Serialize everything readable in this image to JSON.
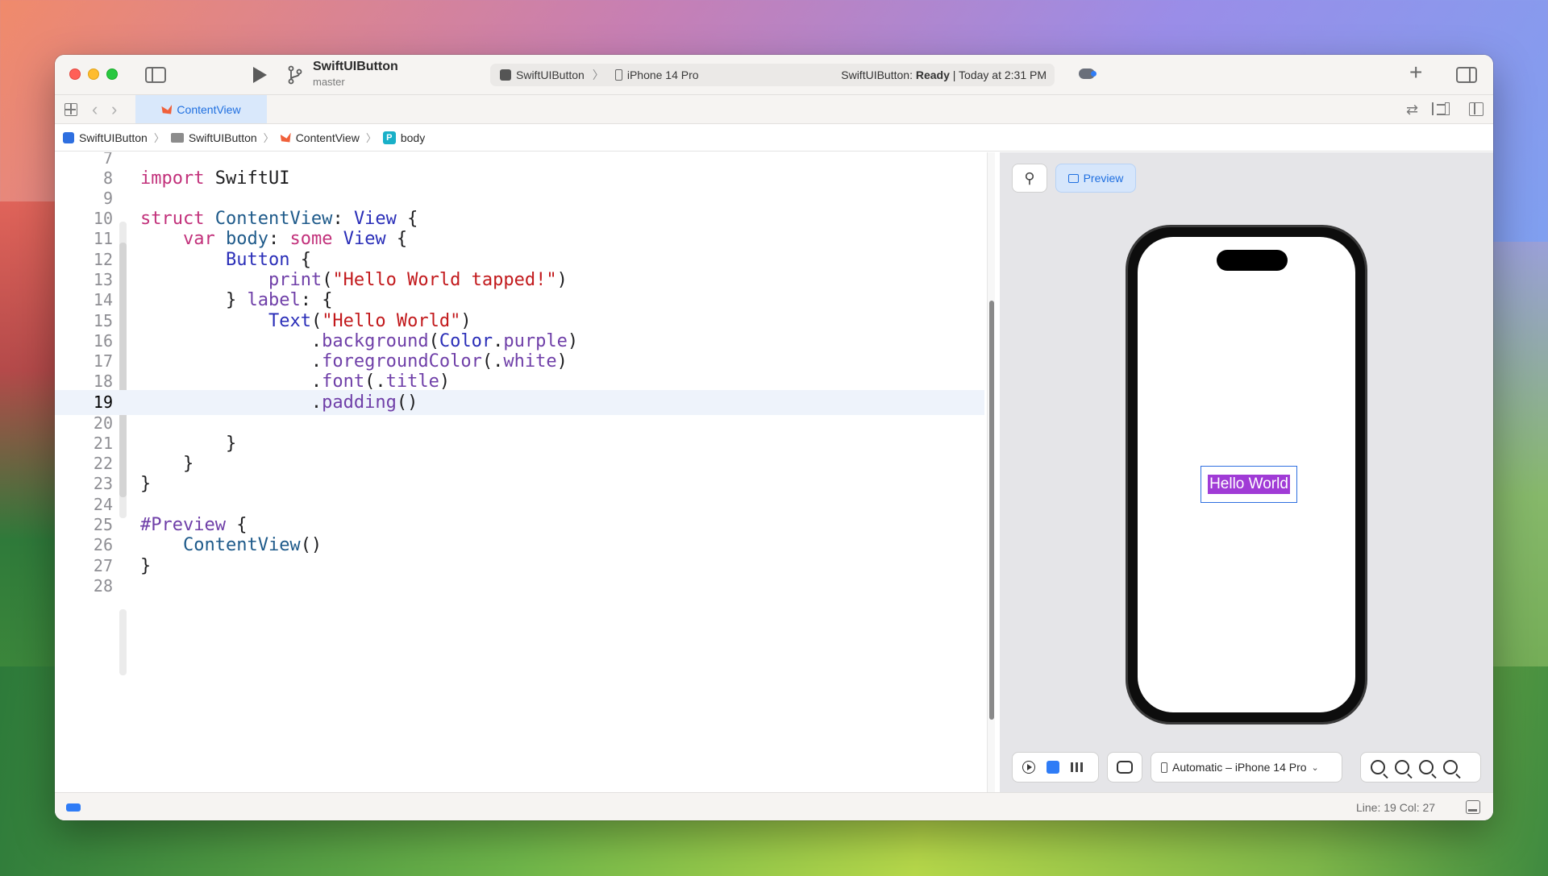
{
  "toolbar": {
    "project_title": "SwiftUIButton",
    "branch": "master",
    "scheme": "SwiftUIButton",
    "destination": "iPhone 14 Pro",
    "status_prefix": "SwiftUIButton:",
    "status_state": "Ready",
    "status_time": "| Today at 2:31 PM"
  },
  "tabs": [
    {
      "label": "ContentView",
      "active": true
    }
  ],
  "breadcrumb": [
    "SwiftUIButton",
    "SwiftUIButton",
    "ContentView",
    "body"
  ],
  "editor": {
    "current_line": 19,
    "lines": [
      {
        "n": "7"
      },
      {
        "n": "8"
      },
      {
        "n": "9"
      },
      {
        "n": "10"
      },
      {
        "n": "11"
      },
      {
        "n": "12"
      },
      {
        "n": "13"
      },
      {
        "n": "14"
      },
      {
        "n": "15"
      },
      {
        "n": "16"
      },
      {
        "n": "17"
      },
      {
        "n": "18"
      },
      {
        "n": "19"
      },
      {
        "n": "20"
      },
      {
        "n": "21"
      },
      {
        "n": "22"
      },
      {
        "n": "23"
      },
      {
        "n": "24"
      },
      {
        "n": "25"
      },
      {
        "n": "26"
      },
      {
        "n": "27"
      },
      {
        "n": "28"
      }
    ],
    "tokens": {
      "import": "import",
      "swiftui": " SwiftUI",
      "struct": "struct",
      "contentview": " ContentView",
      "colon_view": ": ",
      "view": "View",
      "brace_open": " {",
      "var": "var",
      "body": " body",
      "colon": ": ",
      "some": "some",
      "view2": " View",
      "brace2": " {",
      "button": "Button",
      "brace3": " {",
      "print": "print",
      "paren_open": "(",
      "hello_tapped": "\"Hello World tapped!\"",
      "paren_close": ")",
      "close_label": "} ",
      "label": "label",
      "label_rest": ": {",
      "text": "Text",
      "text_paren": "(",
      "hello_world": "\"Hello World\"",
      "text_close": ")",
      "bg_dot": ".",
      "background": "background",
      "bg_paren": "(",
      "color": "Color",
      "color_dot": ".",
      "purple": "purple",
      "bg_close": ")",
      "fg_dot": ".",
      "foreground": "foregroundColor",
      "fg_paren": "(.",
      "white": "white",
      "fg_close": ")",
      "font_dot": ".",
      "font": "font",
      "font_paren": "(.",
      "title": "title",
      "font_close": ")",
      "pad_dot": ".",
      "padding": "padding",
      "pad_paren": "()",
      "close_brace": "}",
      "preview": "#Preview",
      "preview_brace": " {",
      "contentview_call": "ContentView",
      "call_paren": "()"
    }
  },
  "canvas": {
    "preview_label": "Preview",
    "preview_text": "Hello World",
    "device_selector": "Automatic – iPhone 14 Pro"
  },
  "statusbar": {
    "cursor": "Line: 19  Col: 27"
  },
  "colors": {
    "accent": "#2f7cf6",
    "keyword": "#c2317b",
    "string": "#c2191c",
    "purple_bg": "#a03bd6"
  }
}
